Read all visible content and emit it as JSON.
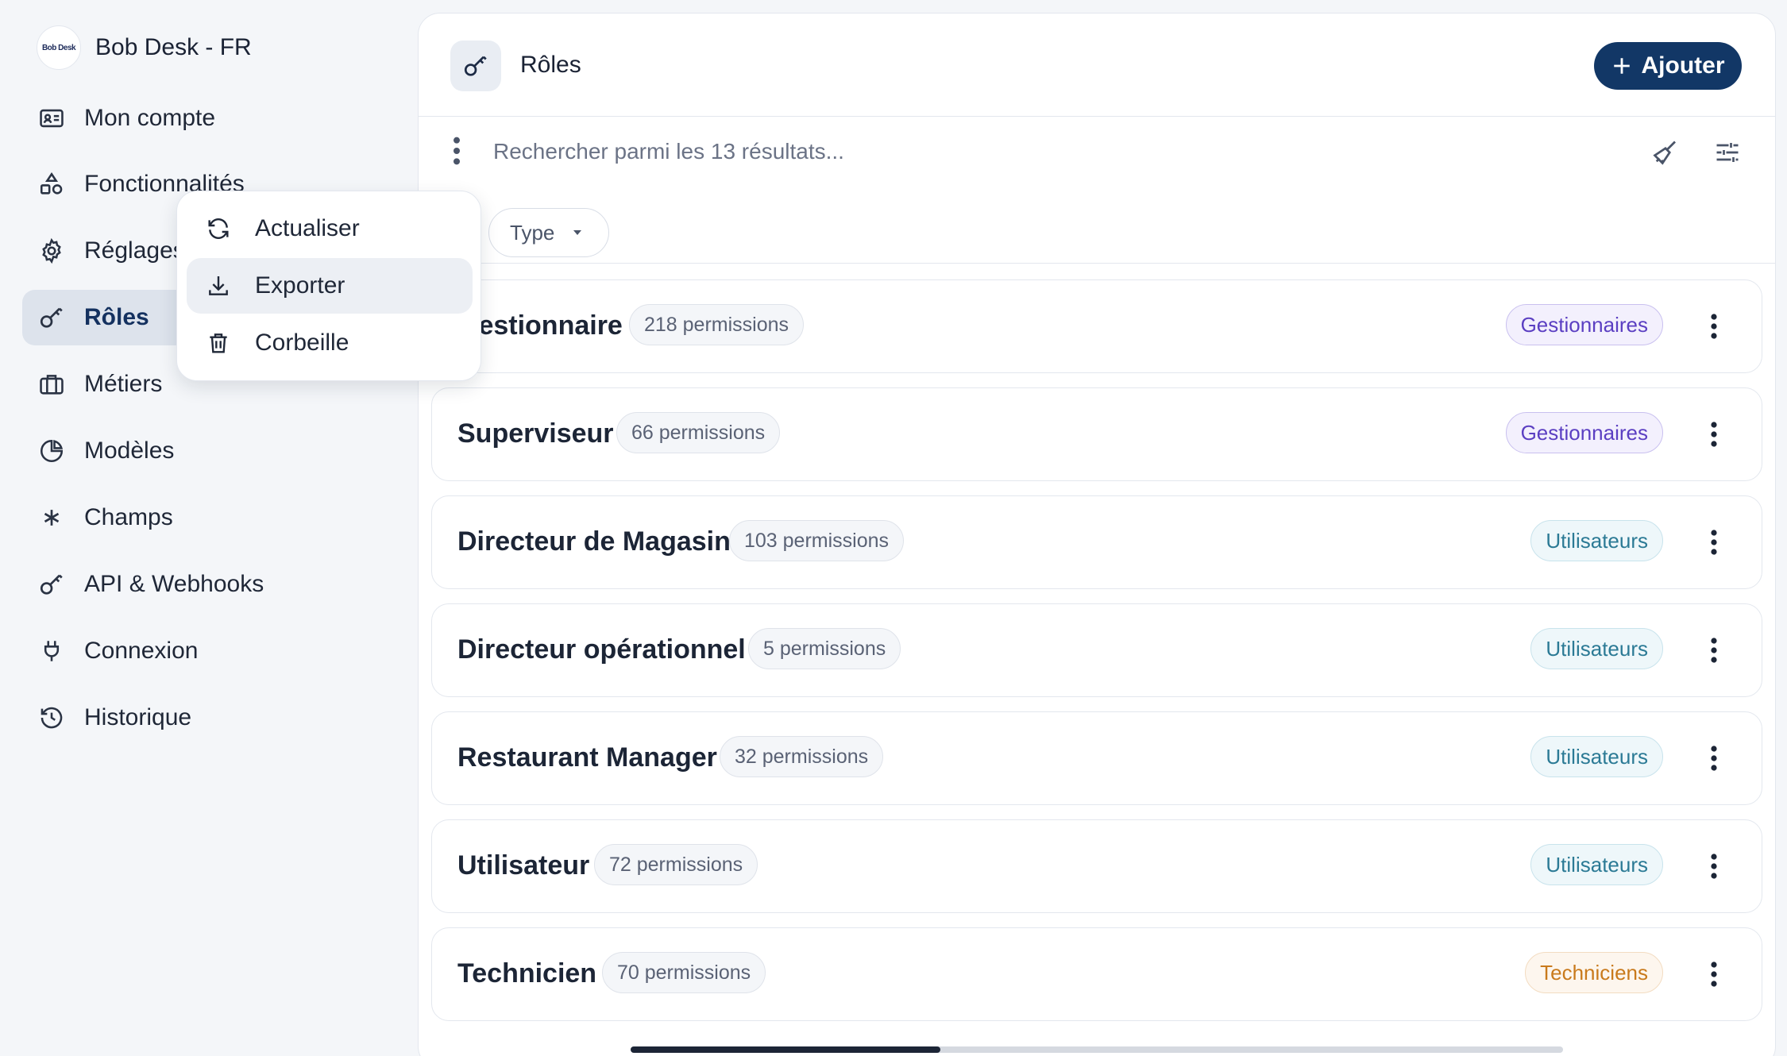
{
  "brand": {
    "logo_text": "Bob Desk",
    "name": "Bob Desk - FR"
  },
  "sidebar": {
    "items": [
      {
        "label": "Mon compte",
        "icon": "id-card-icon"
      },
      {
        "label": "Fonctionnalités",
        "icon": "shapes-icon"
      },
      {
        "label": "Réglages",
        "icon": "gear-icon"
      },
      {
        "label": "Rôles",
        "icon": "key-icon",
        "active": true
      },
      {
        "label": "Métiers",
        "icon": "briefcase-icon"
      },
      {
        "label": "Modèles",
        "icon": "pie-chart-icon"
      },
      {
        "label": "Champs",
        "icon": "asterisk-icon"
      },
      {
        "label": "API & Webhooks",
        "icon": "key-icon"
      },
      {
        "label": "Connexion",
        "icon": "plug-icon"
      },
      {
        "label": "Historique",
        "icon": "history-icon"
      }
    ]
  },
  "header": {
    "title": "Rôles",
    "add_label": "Ajouter"
  },
  "search": {
    "placeholder": "Rechercher parmi les 13 résultats..."
  },
  "filters": {
    "type_label": "Type"
  },
  "context_menu": {
    "items": [
      {
        "label": "Actualiser",
        "icon": "refresh-icon"
      },
      {
        "label": "Exporter",
        "icon": "download-icon",
        "hovered": true
      },
      {
        "label": "Corbeille",
        "icon": "trash-icon"
      }
    ]
  },
  "roles": [
    {
      "name": "Gestionnaire",
      "permissions": "218 permissions",
      "type": "Gestionnaires"
    },
    {
      "name": "Superviseur",
      "permissions": "66 permissions",
      "type": "Gestionnaires"
    },
    {
      "name": "Directeur de Magasin",
      "permissions": "103 permissions",
      "type": "Utilisateurs"
    },
    {
      "name": "Directeur opérationnel",
      "permissions": "5 permissions",
      "type": "Utilisateurs"
    },
    {
      "name": "Restaurant Manager",
      "permissions": "32 permissions",
      "type": "Utilisateurs"
    },
    {
      "name": "Utilisateur",
      "permissions": "72 permissions",
      "type": "Utilisateurs"
    },
    {
      "name": "Technicien",
      "permissions": "70 permissions",
      "type": "Techniciens"
    }
  ],
  "colors": {
    "primary": "#123766",
    "sidebar_active": "#dde3ec",
    "badge_gestionnaires": "#5b3fc2",
    "badge_utilisateurs": "#2b7a95",
    "badge_techniciens": "#c97a1c"
  }
}
